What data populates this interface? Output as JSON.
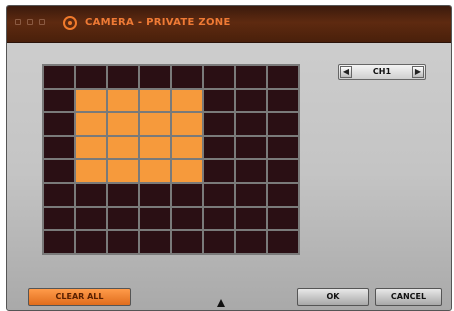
{
  "window": {
    "title": "CAMERA - PRIVATE ZONE",
    "title_color": "#ef7a35"
  },
  "zone_grid": {
    "rows": 8,
    "cols": 8,
    "active_color": "#f69a3c",
    "inactive_color": "#2a0f14",
    "selected": [
      [
        1,
        1
      ],
      [
        1,
        2
      ],
      [
        1,
        3
      ],
      [
        1,
        4
      ],
      [
        2,
        1
      ],
      [
        2,
        2
      ],
      [
        2,
        3
      ],
      [
        2,
        4
      ],
      [
        3,
        1
      ],
      [
        3,
        2
      ],
      [
        3,
        3
      ],
      [
        3,
        4
      ],
      [
        4,
        1
      ],
      [
        4,
        2
      ],
      [
        4,
        3
      ],
      [
        4,
        4
      ]
    ]
  },
  "channel_selector": {
    "value": "CH1",
    "prev_icon": "left-arrow-icon",
    "next_icon": "right-arrow-icon"
  },
  "buttons": {
    "clear_all": "CLEAR ALL",
    "ok": "OK",
    "cancel": "CANCEL"
  }
}
